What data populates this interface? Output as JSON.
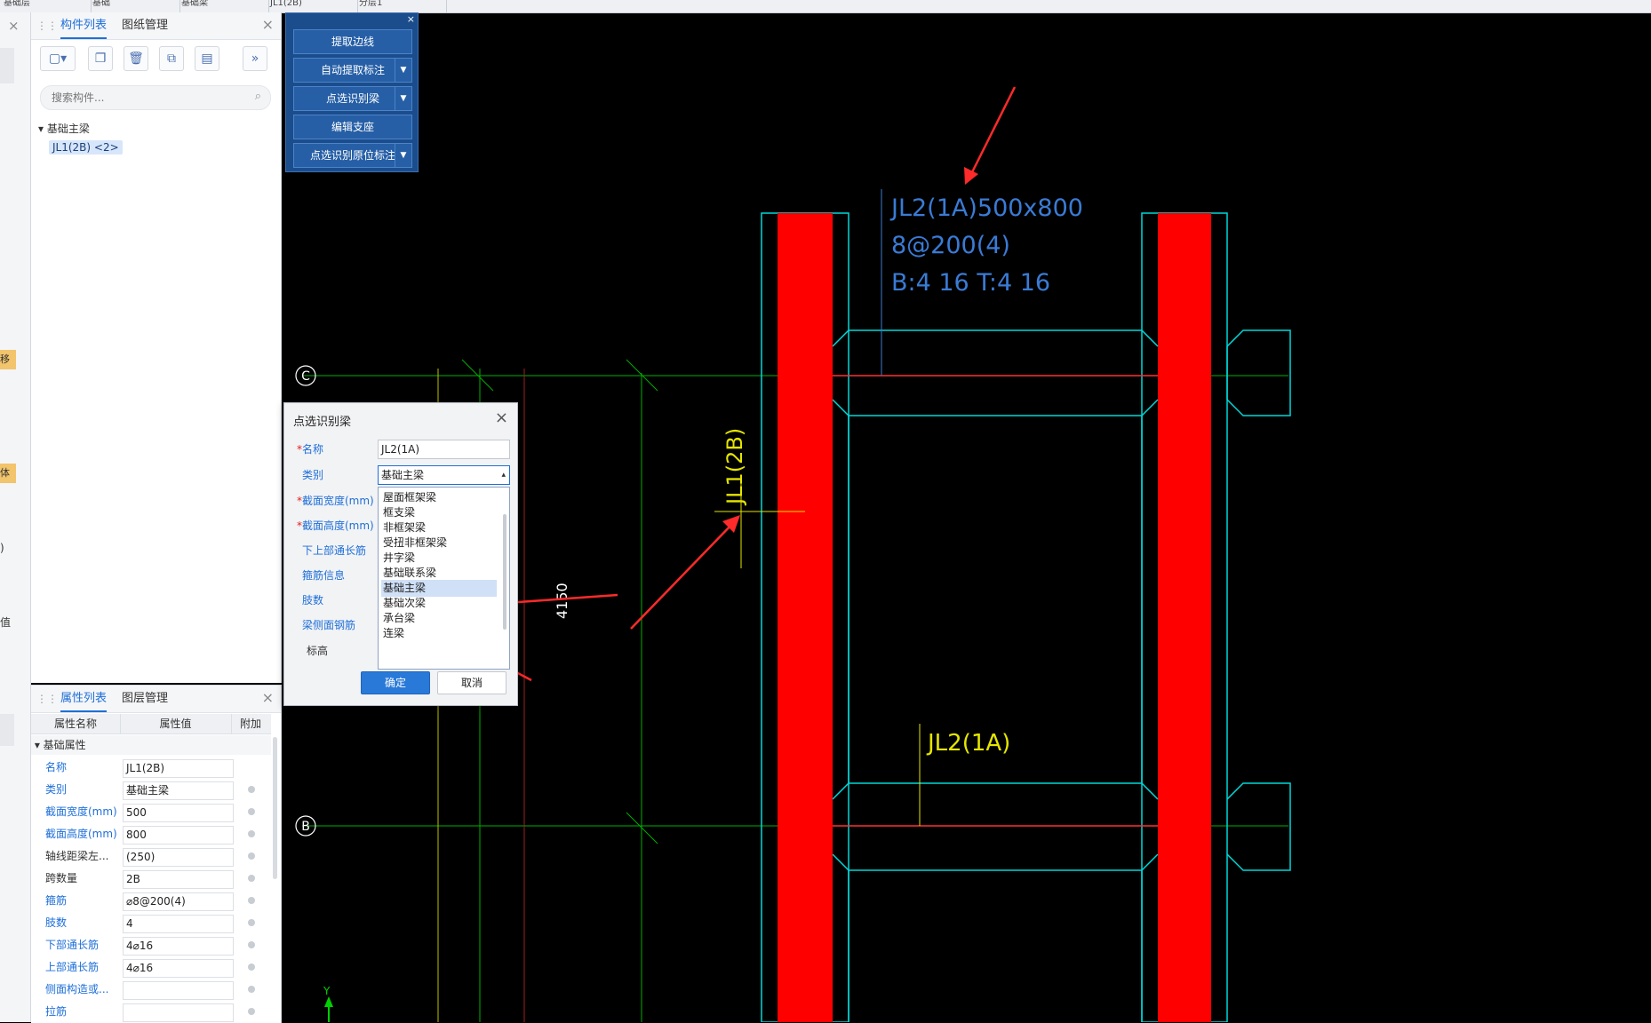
{
  "top_tabs": [
    "基础层",
    "基础",
    "基础梁",
    "JL1(2B)",
    "分层1"
  ],
  "left_strip": {
    "badge1": "移验",
    "badge2": "体验",
    "letter1": ")",
    "letter2": "值"
  },
  "component_panel": {
    "tabs": [
      "构件列表",
      "图纸管理"
    ],
    "search_placeholder": "搜索构件...",
    "tree_group": "基础主梁",
    "tree_item": "JL1(2B) <2>",
    "toolbar_more": "»"
  },
  "property_panel": {
    "tabs": [
      "属性列表",
      "图层管理"
    ],
    "columns": [
      "属性名称",
      "属性值",
      "附加"
    ],
    "group": "基础属性",
    "rows": [
      {
        "name": "名称",
        "value": "JL1(2B)",
        "blue": true
      },
      {
        "name": "类别",
        "value": "基础主梁",
        "blue": true
      },
      {
        "name": "截面宽度(mm)",
        "value": "500",
        "blue": true
      },
      {
        "name": "截面高度(mm)",
        "value": "800",
        "blue": true
      },
      {
        "name": "轴线距梁左...",
        "value": "(250)",
        "blue": false
      },
      {
        "name": "跨数量",
        "value": "2B",
        "blue": false
      },
      {
        "name": "箍筋",
        "value": "⌀8@200(4)",
        "blue": true
      },
      {
        "name": "肢数",
        "value": "4",
        "blue": true
      },
      {
        "name": "下部通长筋",
        "value": "4⌀16",
        "blue": true
      },
      {
        "name": "上部通长筋",
        "value": "4⌀16",
        "blue": true
      },
      {
        "name": "侧面构造或...",
        "value": "",
        "blue": true
      },
      {
        "name": "拉筋",
        "value": "",
        "blue": true
      }
    ]
  },
  "toolbox": {
    "buttons": [
      {
        "label": "提取边线",
        "dropdown": false
      },
      {
        "label": "自动提取标注",
        "dropdown": true
      },
      {
        "label": "点选识别梁",
        "dropdown": true
      },
      {
        "label": "编辑支座",
        "dropdown": false
      },
      {
        "label": "点选识别原位标注",
        "dropdown": true
      }
    ]
  },
  "dialog": {
    "title": "点选识别梁",
    "labels": [
      "名称",
      "类别",
      "截面宽度(mm)",
      "截面高度(mm)",
      "下上部通长筋",
      "箍筋信息",
      "肢数",
      "梁侧面钢筋",
      "标高"
    ],
    "name_value": "JL2(1A)",
    "category_value": "基础主梁",
    "options": [
      "屋面框架梁",
      "框支梁",
      "非框架梁",
      "受扭非框架梁",
      "井字梁",
      "基础联系梁",
      "基础主梁",
      "基础次梁",
      "承台梁",
      "连梁"
    ],
    "selected_option": "基础主梁",
    "ok": "确定",
    "cancel": "取消"
  },
  "drawing": {
    "beam_label_main": "JL2(1A)500x800",
    "beam_label_stirrup": "8@200(4)",
    "beam_label_bars": "B:4  16   T:4  16",
    "beam_label_vertical": "JL1(2B)",
    "beam_label_small": "JL2(1A)",
    "dimension": "4150",
    "axis_c": "C",
    "axis_b": "B",
    "axis_y": "Y"
  },
  "colors": {
    "canvas": "#000000",
    "beam_fill": "#ff0000",
    "outline": "#00e5e5",
    "text_blue": "#3a7bd5",
    "text_yellow": "#e5e500",
    "axis_green": "#00c000",
    "arrow": "#ff2a2a"
  }
}
